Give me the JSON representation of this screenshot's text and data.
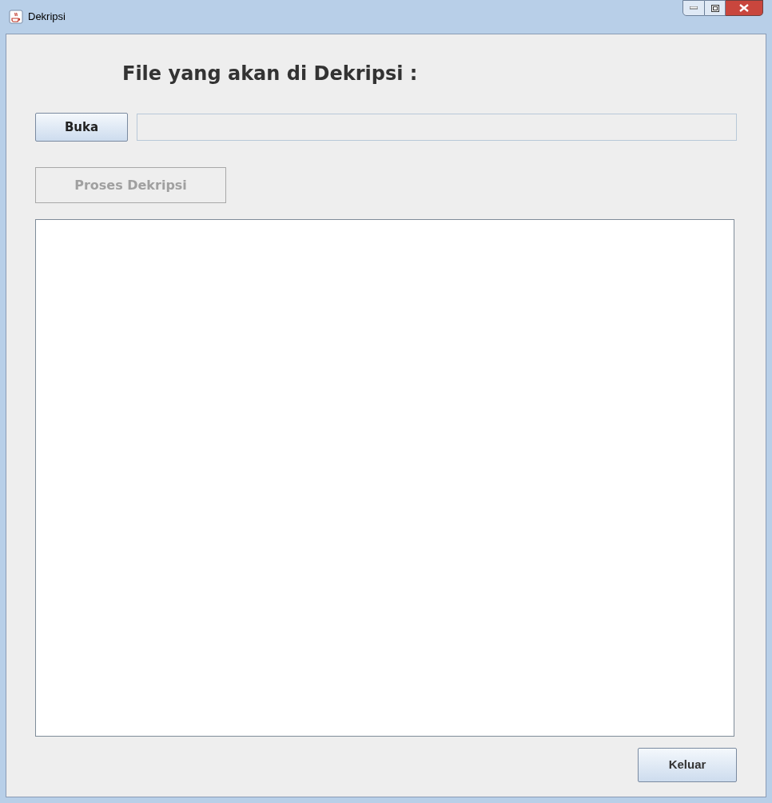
{
  "window": {
    "title": "Dekripsi"
  },
  "heading": "File yang akan di Dekripsi :",
  "open_button": {
    "label": "Buka"
  },
  "process_button": {
    "label": "Proses Dekripsi",
    "disabled": true
  },
  "exit_button": {
    "label": "Keluar"
  }
}
